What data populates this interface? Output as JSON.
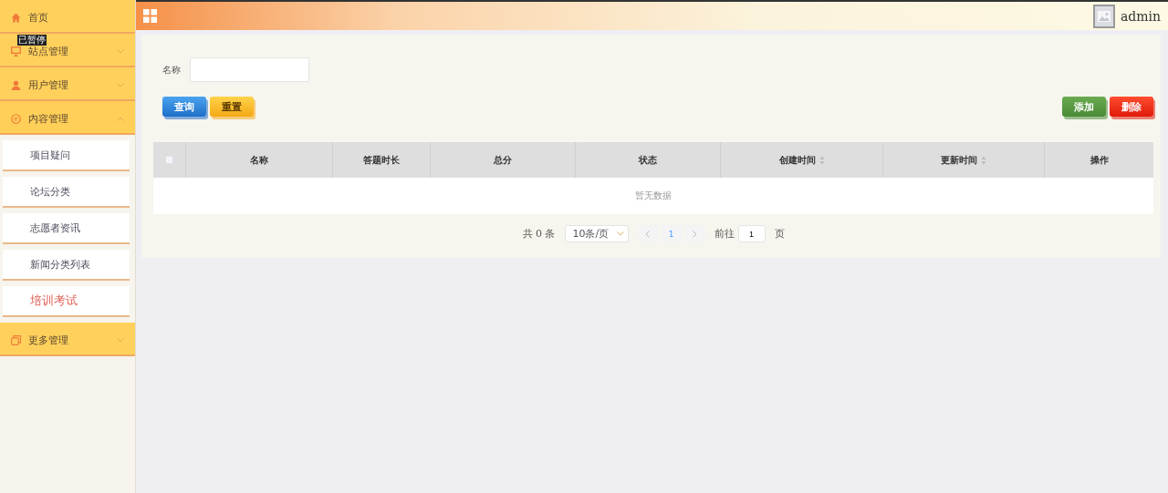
{
  "sidebar": {
    "items": [
      {
        "label": "首页"
      },
      {
        "label": "站点管理",
        "expanded": false
      },
      {
        "label": "用户管理",
        "expanded": false
      },
      {
        "label": "内容管理",
        "expanded": true,
        "children": [
          {
            "label": "项目疑问",
            "selected": false
          },
          {
            "label": "论坛分类",
            "selected": false
          },
          {
            "label": "志愿者资讯",
            "selected": false
          },
          {
            "label": "新闻分类列表",
            "selected": false
          },
          {
            "label": "培训考试",
            "selected": true
          }
        ]
      },
      {
        "label": "更多管理",
        "expanded": false
      }
    ]
  },
  "overlay_badge": "已暂停",
  "header": {
    "username": "admin"
  },
  "search": {
    "label": "名称",
    "buttons": [
      {
        "label": "查询",
        "kind": "query"
      },
      {
        "label": "重置",
        "kind": "reset"
      }
    ]
  },
  "actions": [
    {
      "label": "添加",
      "kind": "add"
    },
    {
      "label": "删除",
      "kind": "delete"
    }
  ],
  "table": {
    "select_all": {
      "checked": false
    },
    "columns": [
      {
        "label": "名称",
        "sortable": false
      },
      {
        "label": "答题时长",
        "sortable": false
      },
      {
        "label": "总分",
        "sortable": false
      },
      {
        "label": "状态",
        "sortable": false
      },
      {
        "label": "创建时间",
        "sortable": true
      },
      {
        "label": "更新时间",
        "sortable": true
      },
      {
        "label": "操作",
        "sortable": false
      }
    ],
    "empty_text": "暂无数据"
  },
  "pagination": {
    "total": "共 0 条",
    "page_size": "10条/页",
    "current_page": "1",
    "goto_label": "前往",
    "goto_value": "1",
    "page_suffix": "页"
  }
}
